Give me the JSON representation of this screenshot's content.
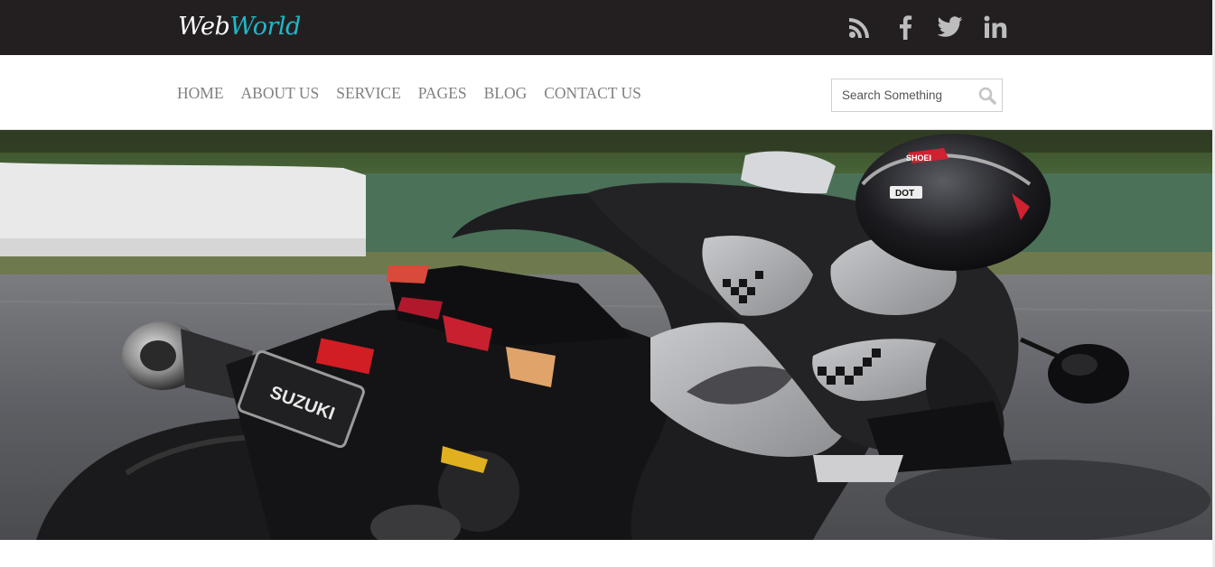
{
  "header": {
    "logo": {
      "part1": "Web",
      "part2": "World"
    },
    "social": [
      {
        "name": "rss-icon"
      },
      {
        "name": "facebook-icon"
      },
      {
        "name": "twitter-icon"
      },
      {
        "name": "linkedin-icon"
      }
    ]
  },
  "nav": {
    "items": [
      "HOME",
      "ABOUT US",
      "SERVICE",
      "PAGES",
      "BLOG",
      "CONTACT US"
    ]
  },
  "search": {
    "placeholder": "Search Something",
    "icon": "search-icon"
  },
  "hero": {
    "image": "motorcycle-racer-photo",
    "plate_text": "SUZUKI",
    "helmet_text": "SHOEI",
    "helmet_badge": "DOT"
  },
  "colors": {
    "topbar_bg": "#231f20",
    "logo_accent": "#1fb8c9",
    "nav_text": "#808080",
    "icon_gray": "#bdbdbd"
  }
}
